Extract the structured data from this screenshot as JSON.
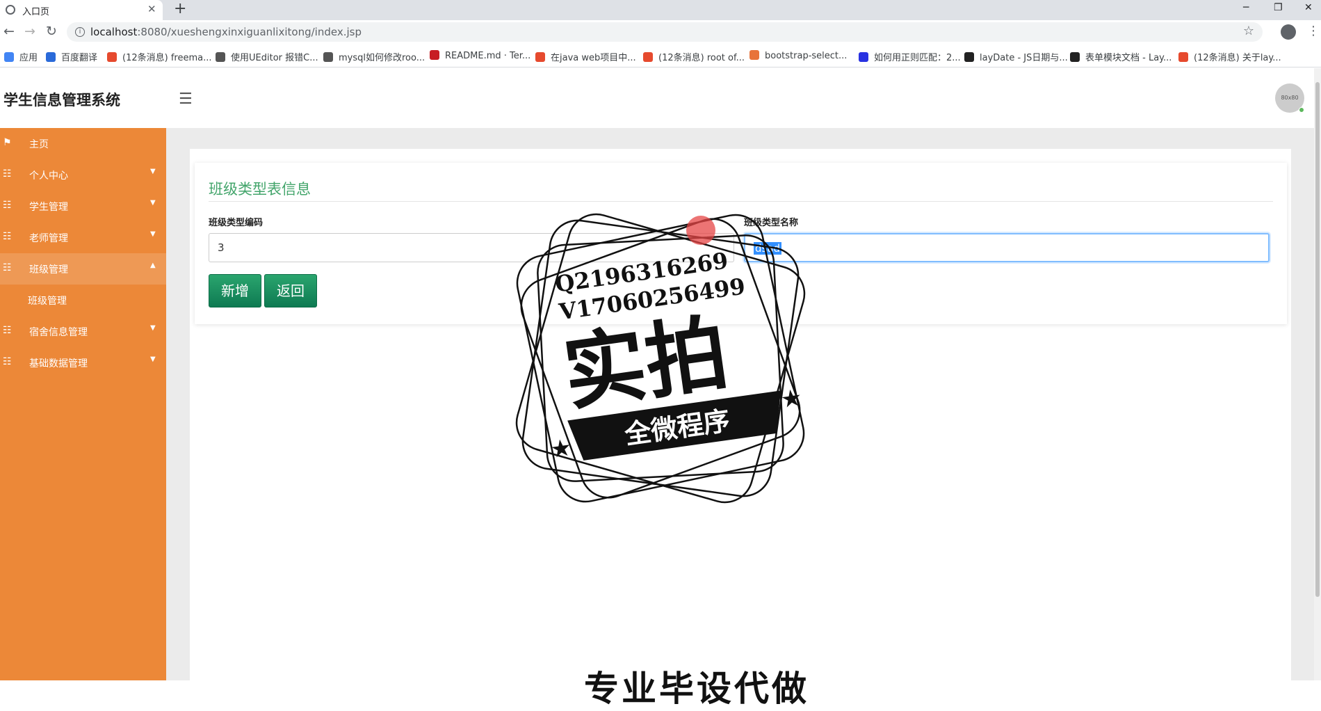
{
  "browser": {
    "tab_title": "入口页",
    "url_host": "localhost",
    "url_rest": ":8080/xueshengxinxiguanlixitong/index.jsp",
    "bookmarks": [
      {
        "label": "应用",
        "color": "#4285f4"
      },
      {
        "label": "百度翻译",
        "color": "#2a6ad9"
      },
      {
        "label": "(12条消息) freema...",
        "color": "#e64a2e"
      },
      {
        "label": "使用UEditor 报错C...",
        "color": "#555555"
      },
      {
        "label": "mysql如何修改roo...",
        "color": "#555555"
      },
      {
        "label": "README.md · Ter...",
        "color": "#c71d23"
      },
      {
        "label": "在java web项目中...",
        "color": "#e64a2e"
      },
      {
        "label": "(12条消息) root of...",
        "color": "#e64a2e"
      },
      {
        "label": "bootstrap-select...",
        "color": "#e8733a"
      },
      {
        "label": "如何用正则匹配：2...",
        "color": "#2932e1"
      },
      {
        "label": "layDate - JS日期与...",
        "color": "#222222"
      },
      {
        "label": "表单模块文档 - Lay...",
        "color": "#222222"
      },
      {
        "label": "(12条消息) 关于lay...",
        "color": "#e64a2e"
      }
    ]
  },
  "header": {
    "title": "学生信息管理系统",
    "avatar_text": "80x80"
  },
  "sidebar": {
    "items": [
      {
        "label": "主页",
        "icon": "flag-icon",
        "caret": ""
      },
      {
        "label": "个人中心",
        "icon": "grid-icon",
        "caret": "▼"
      },
      {
        "label": "学生管理",
        "icon": "grid-icon",
        "caret": "▼"
      },
      {
        "label": "老师管理",
        "icon": "grid-icon",
        "caret": "▼"
      },
      {
        "label": "班级管理",
        "icon": "grid-icon",
        "caret": "▲"
      },
      {
        "label": "宿舍信息管理",
        "icon": "grid-icon",
        "caret": "▼"
      },
      {
        "label": "基础数据管理",
        "icon": "grid-icon",
        "caret": "▼"
      }
    ],
    "sub_item": "班级管理"
  },
  "form": {
    "title": "班级类型表信息",
    "code_label": "班级类型编码",
    "code_value": "3",
    "name_label": "班级类型名称",
    "name_value": "dsad",
    "add_button": "新增",
    "back_button": "返回"
  },
  "watermark": {
    "line1": "Q2196316269",
    "line2": "V17060256499",
    "main": "实拍",
    "ribbon": "全微程序"
  },
  "bottom_text": "专业毕设代做",
  "colors": {
    "sidebar": "#ec8838",
    "accent_green": "#43a56b",
    "button_green": "#0e7a52"
  }
}
